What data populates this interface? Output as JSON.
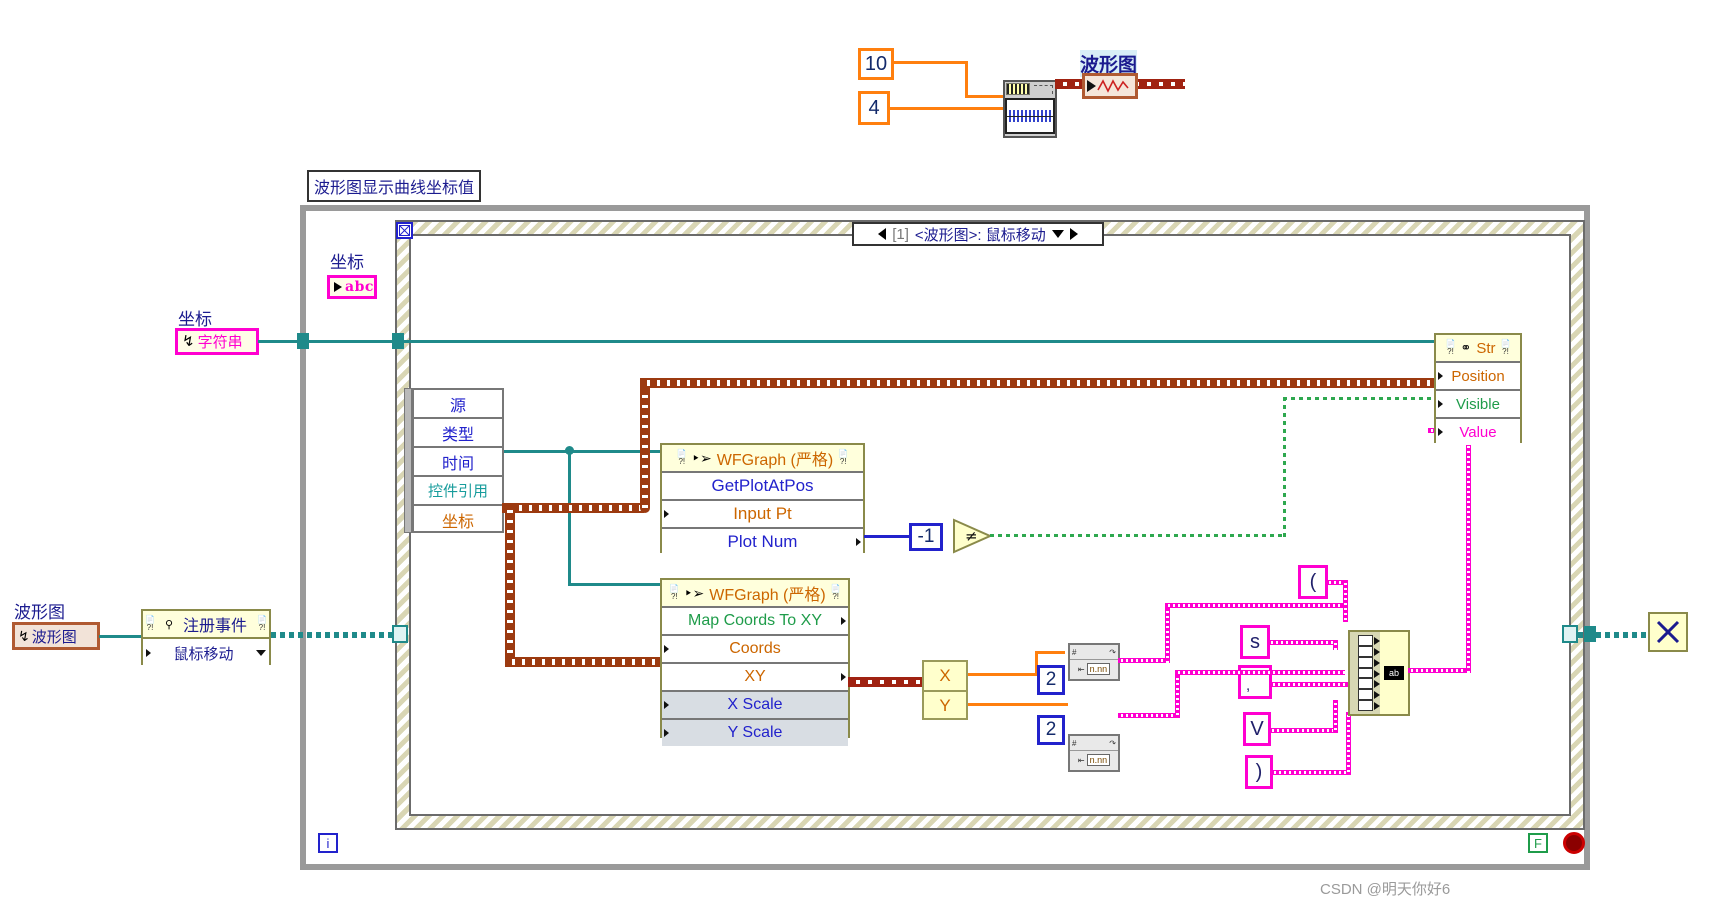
{
  "diagram": {
    "title": "LabVIEW Block Diagram",
    "watermark": "CSDN @明天你好6"
  },
  "top_section": {
    "const_samples": "10",
    "const_freq": "4",
    "express_vi_name": "simulate-signal-express-vi",
    "graph_terminal_label": "波形图",
    "graph_terminal_icon": "waveform-graph-icon"
  },
  "free_label": "波形图显示曲线坐标值",
  "event_structure": {
    "case_index": "[1]",
    "case_text": "<波形图>: 鼠标移动",
    "left_arrow": "◀",
    "right_arrow": "▶",
    "dropdown": "▼"
  },
  "left_terminals": {
    "coord_indicator_label": "坐标",
    "coord_indicator_type": "abc",
    "coord_string_label": "坐标",
    "coord_string_text": "字符串",
    "graph_ref_label": "波形图",
    "graph_ref_text": "波形图"
  },
  "register_events": {
    "title": "注册事件",
    "event_row": "鼠标移动"
  },
  "unbundle": {
    "rows": [
      {
        "label": "源",
        "color": "blue"
      },
      {
        "label": "类型",
        "color": "blue"
      },
      {
        "label": "时间",
        "color": "blue"
      },
      {
        "label": "控件引用",
        "color": "teal"
      },
      {
        "label": "坐标",
        "color": "orange"
      }
    ]
  },
  "wfgraph_node_1": {
    "header": "WFGraph (严格)",
    "method": "GetPlotAtPos",
    "rows": [
      {
        "label": "Input Pt",
        "color": "orange"
      },
      {
        "label": "Plot Num",
        "color": "blue"
      }
    ]
  },
  "wfgraph_node_2": {
    "header": "WFGraph (严格)",
    "method": "Map Coords To XY",
    "rows": [
      {
        "label": "Coords",
        "color": "orange",
        "grey": false
      },
      {
        "label": "XY",
        "color": "orange",
        "grey": false
      },
      {
        "label": "X Scale",
        "color": "blue",
        "grey": true
      },
      {
        "label": "Y Scale",
        "color": "blue",
        "grey": true
      }
    ]
  },
  "property_node_str": {
    "header": "Str",
    "rows": [
      {
        "label": "Position",
        "color": "orange"
      },
      {
        "label": "Visible",
        "color": "green"
      },
      {
        "label": "Value",
        "color": "magenta"
      }
    ]
  },
  "math": {
    "minus_one": "-1",
    "compare_icon": "not-equal-icon"
  },
  "split_xy": {
    "x": "X",
    "y": "Y"
  },
  "num_to_string": {
    "precision_top": "2",
    "precision_bottom": "2",
    "icon": "number-to-fractional-string-icon"
  },
  "string_constants": {
    "open_paren": "(",
    "s_char": "s",
    "comma": ",",
    "v_char": "V",
    "close_paren": ")"
  },
  "concatenate": {
    "icon": "concatenate-strings-icon"
  },
  "loop": {
    "iteration_label": "i",
    "conditional_label": "F",
    "stop_button": "stop-sign-icon"
  },
  "right_node": {
    "label": "unregister-events-icon"
  }
}
